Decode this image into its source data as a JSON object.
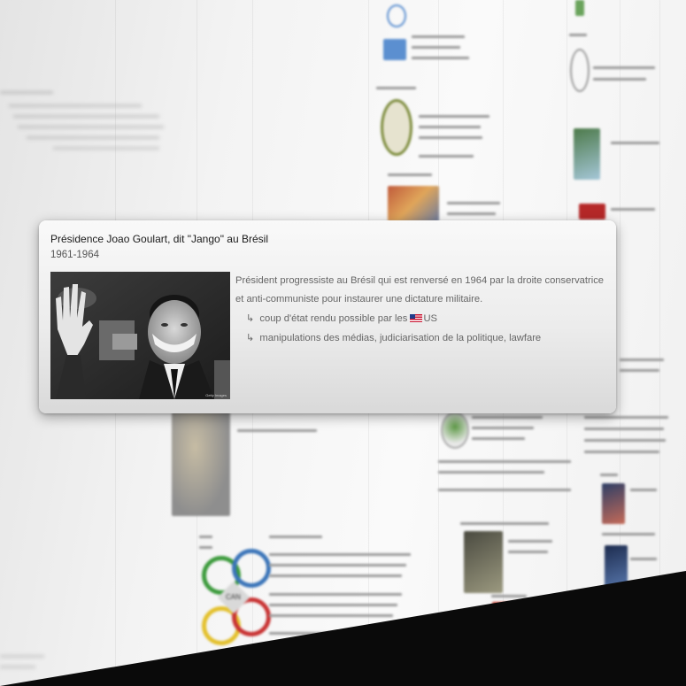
{
  "card": {
    "title": "Présidence Joao Goulart, dit \"Jango\" au Brésil",
    "date": "1961-1964",
    "description": "Président progressiste au Brésil qui est renversé en 1964 par la droite conservatrice et anti-communiste pour instaurer une dictature militaire.",
    "subpoint_1_prefix": "coup d'état rendu possible par les ",
    "subpoint_1_suffix": "US",
    "subpoint_2": "manipulations des médias, judiciarisation de la politique, lawfare",
    "photo_credit": "Getty Images",
    "flag_icon": "us-flag-icon",
    "arrow_icon": "sub-arrow-icon"
  },
  "background": {
    "can_logo_label": "CAN"
  }
}
